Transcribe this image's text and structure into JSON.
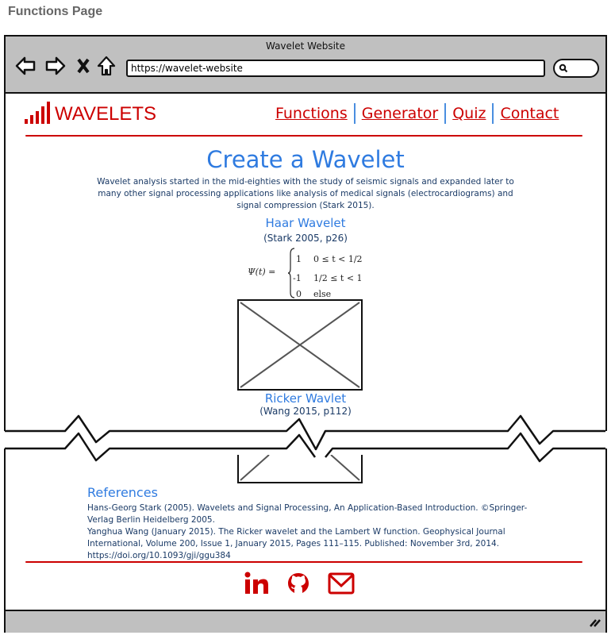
{
  "page_label": "Functions Page",
  "browser": {
    "title": "Wavelet Website",
    "url": "https://wavelet-website",
    "nav_icons": [
      "back-arrow-icon",
      "forward-arrow-icon",
      "close-x-icon",
      "home-icon"
    ],
    "search_icon": "search-icon"
  },
  "header": {
    "logo_text": "WAVELETS",
    "nav": [
      {
        "label": "Functions"
      },
      {
        "label": "Generator"
      },
      {
        "label": "Quiz"
      },
      {
        "label": "Contact"
      }
    ]
  },
  "main": {
    "title": "Create a Wavelet",
    "intro": "Wavelet analysis started in the mid-eighties with the study of seismic signals and expanded later to many other signal processing applications like analysis of medical signals (electrocardiograms) and signal compression (Stark 2015).",
    "sections": [
      {
        "heading": "Haar Wavelet",
        "citation": "(Stark 2005, p26)"
      },
      {
        "heading": "Ricker Wavlet",
        "citation": "(Wang 2015, p112)"
      }
    ],
    "formula": {
      "lhs": "Ψ(t) =",
      "cases": [
        {
          "value": "1",
          "condition": "0 ≤ t < 1/2"
        },
        {
          "value": "-1",
          "condition": "1/2 ≤ t < 1"
        },
        {
          "value": "0",
          "condition": "else"
        }
      ]
    }
  },
  "references": {
    "title": "References",
    "items": [
      "Hans-Georg Stark (2005). Wavelets and Signal Processing, An Application-Based Introduction. ©Springer-Verlag Berlin Heidelberg 2005.",
      "Yanghua Wang (January 2015). The Ricker wavelet and the Lambert W function. Geophysical Journal International, Volume 200, Issue 1, January 2015, Pages 111–115. Published: November 3rd, 2014. https://doi.org/10.1093/gji/ggu384"
    ]
  },
  "footer": {
    "social_icons": [
      "linkedin-icon",
      "github-icon",
      "email-icon"
    ]
  },
  "colors": {
    "accent_red": "#cc0000",
    "heading_blue": "#2f7be0",
    "text_navy": "#1a3a66",
    "chrome_gray": "#c0c0c0"
  }
}
